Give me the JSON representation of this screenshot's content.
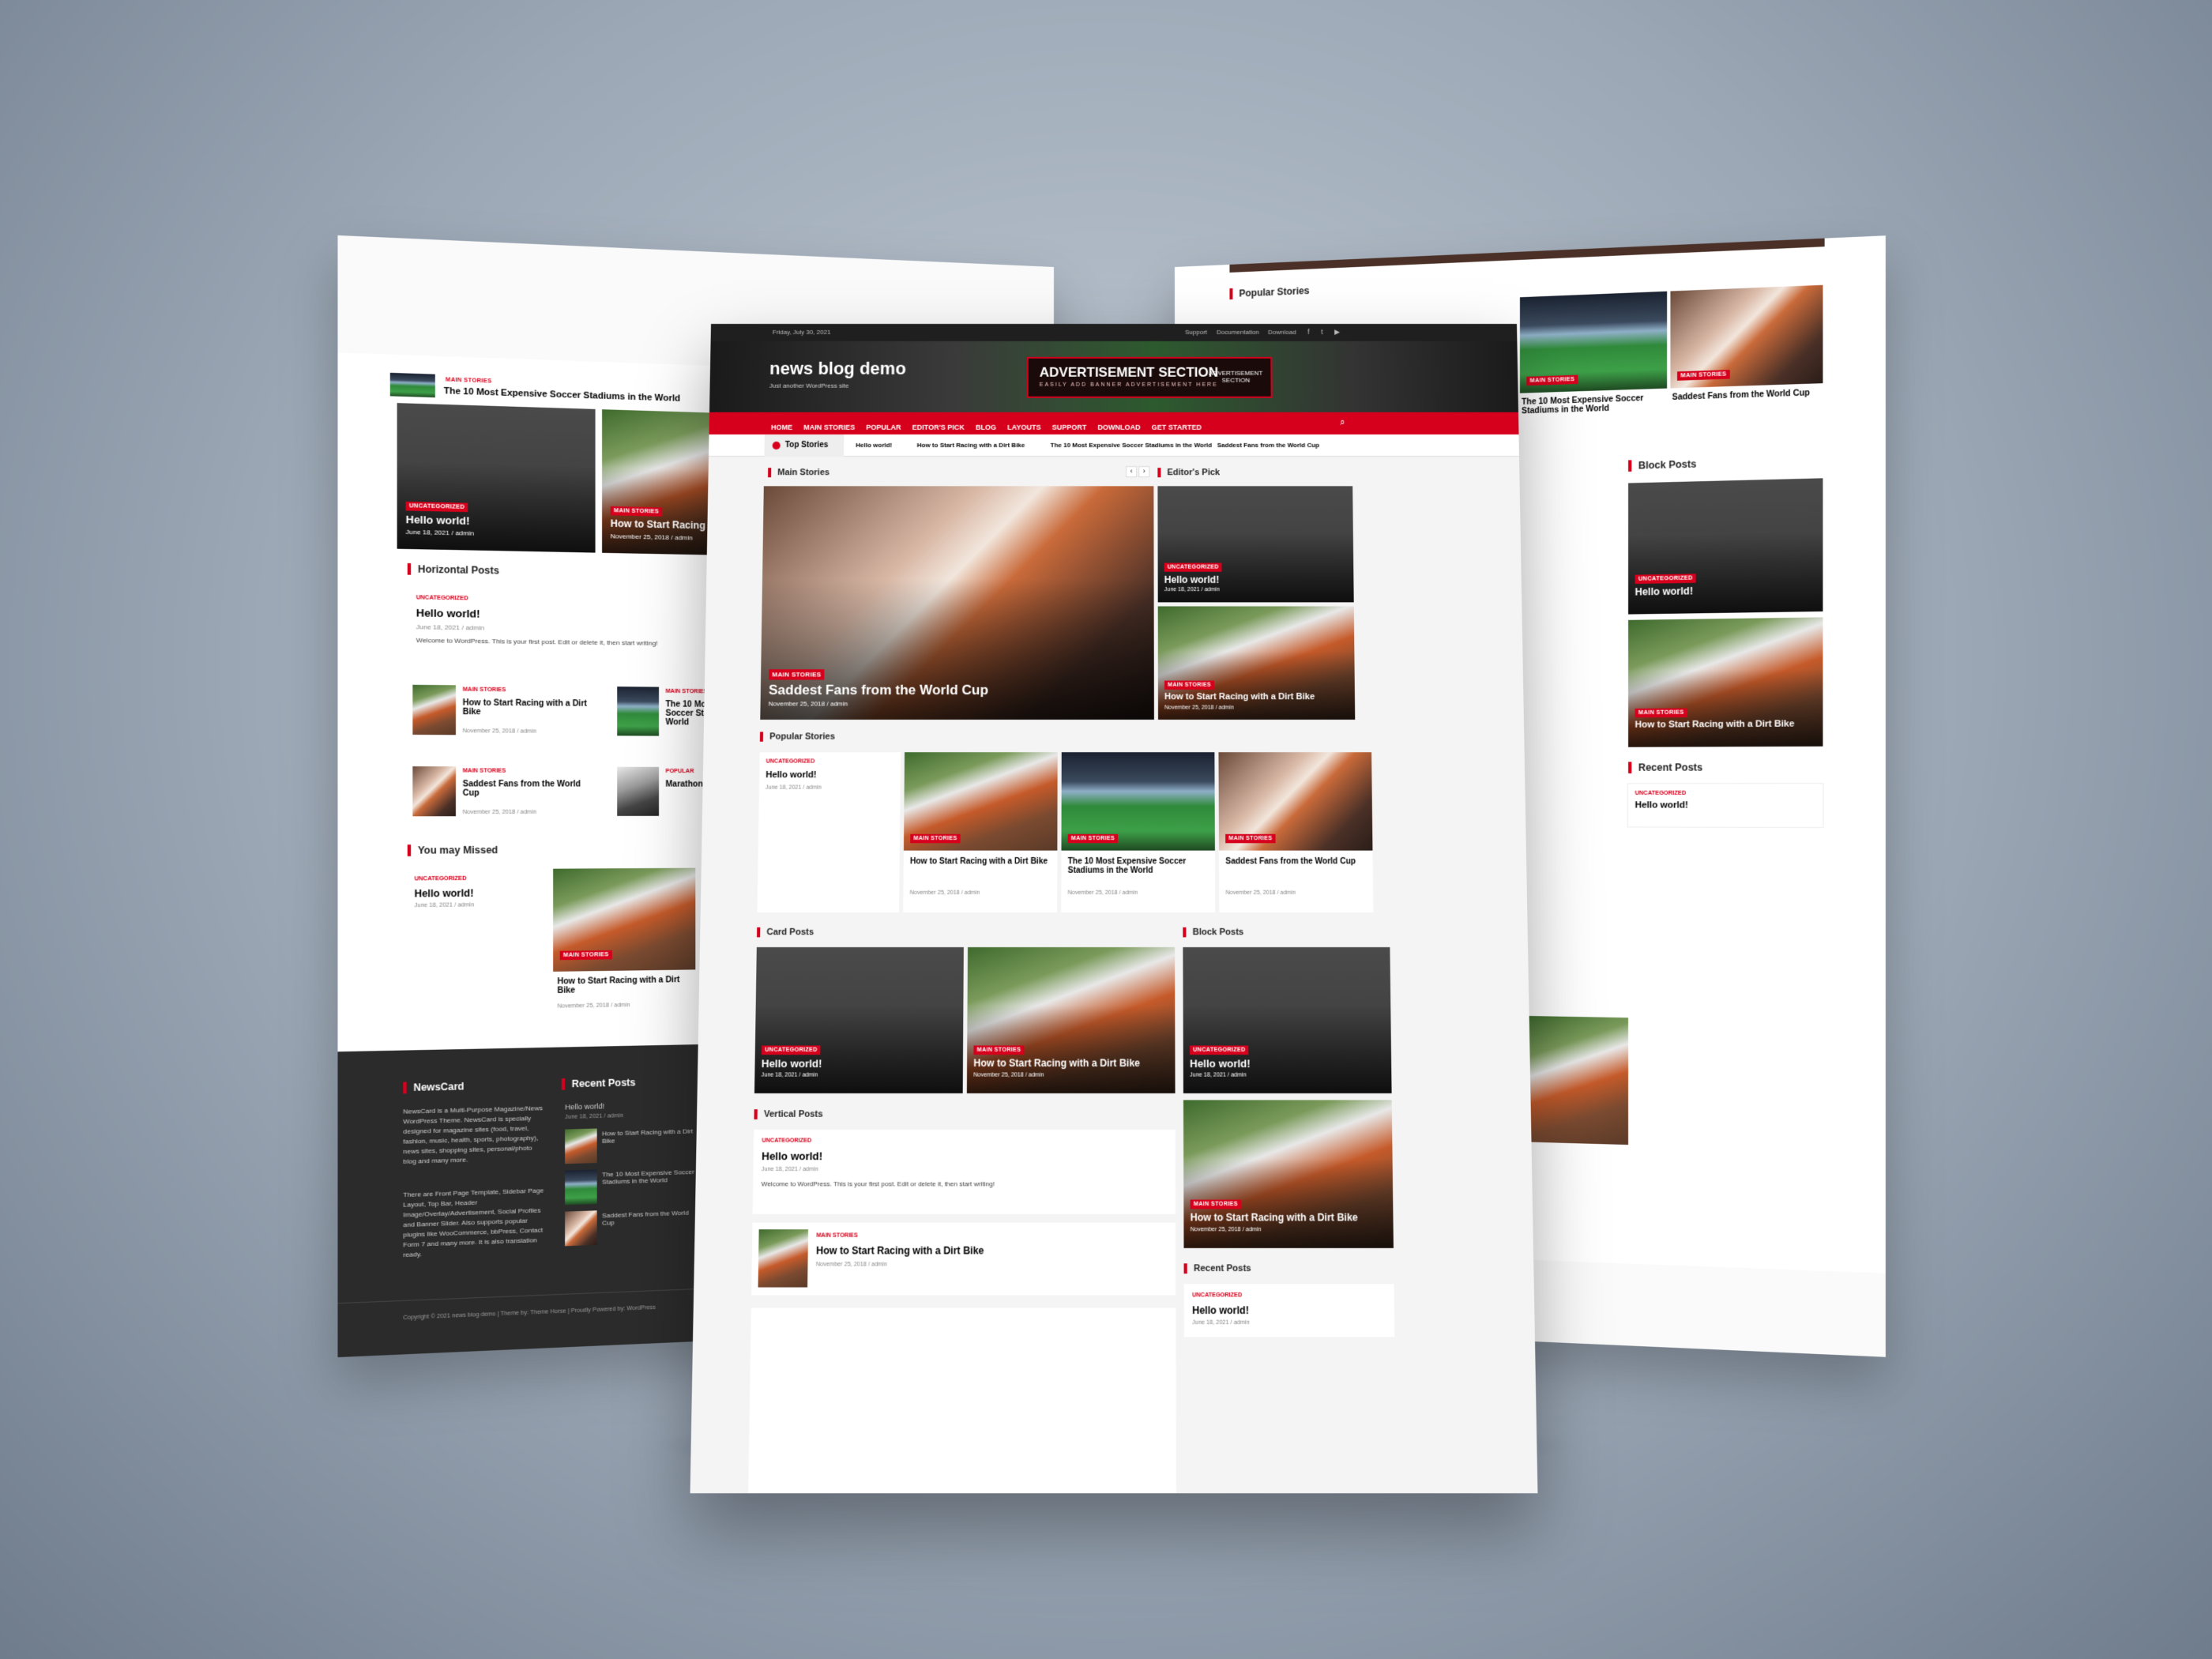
{
  "site": {
    "title": "news blog demo",
    "tagline": "Just another WordPress site",
    "date": "Friday, July 30, 2021"
  },
  "topbar": {
    "links": [
      "Support",
      "Documentation",
      "Download"
    ]
  },
  "ad": {
    "title": "ADVERTISEMENT SECTION",
    "subtitle": "EASILY ADD BANNER ADVERTISEMENT HERE",
    "side": "ADVERTISEMENT SECTION"
  },
  "nav": {
    "items": [
      "HOME",
      "MAIN STORIES",
      "POPULAR",
      "EDITOR'S PICK",
      "BLOG",
      "LAYOUTS",
      "SUPPORT",
      "DOWNLOAD",
      "GET STARTED"
    ]
  },
  "ticker": {
    "label": "Top Stories",
    "items": [
      "Hello world!",
      "How to Start Racing with a Dirt Bike",
      "The 10 Most Expensive Soccer Stadiums in the World",
      "Saddest Fans from the World Cup"
    ]
  },
  "sections": {
    "main": "Main Stories",
    "editors": "Editor's Pick",
    "popular": "Popular Stories",
    "card": "Card Posts",
    "block": "Block Posts",
    "vertical": "Vertical Posts",
    "recent": "Recent Posts",
    "horizontal": "Horizontal Posts",
    "missed": "You may Missed",
    "newscard": "NewsCard"
  },
  "cats": {
    "uncat": "UNCATEGORIZED",
    "main": "MAIN STORIES",
    "popular": "POPULAR"
  },
  "posts": {
    "hello": "Hello world!",
    "dirt": "How to Start Racing with a Dirt Bike",
    "stadium": "The 10 Most Expensive Soccer Stadiums in the World",
    "fans": "Saddest Fans from the World Cup",
    "marathon": "Marathon for a Ca",
    "date_hello": "June 18, 2021 / admin",
    "date_nov": "November 25, 2018 / admin",
    "excerpt": "Welcome to WordPress. This is your first post. Edit or delete it, then start writing!"
  },
  "footer": {
    "about1": "NewsCard is a Multi-Purpose Magazine/News WordPress Theme. NewsCard is specially designed for magazine sites (food, travel, fashion, music, health, sports, photography), news sites, shopping sites, personal/photo blog and many more.",
    "about2": "There are Front Page Template, Sidebar Page Layout, Top Bar, Header Image/Overlay/Advertisement, Social Profiles and Banner Slider. Also supports popular plugins like WooCommerce, bbPress, Contact Form 7 and many more. It is also translation ready.",
    "copyright": "Copyright © 2021 news blog demo | Theme by: Theme Horse | Proudly Powered by: WordPress"
  },
  "colors": {
    "accent": "#d6001c",
    "dark": "#2b2b2b"
  }
}
